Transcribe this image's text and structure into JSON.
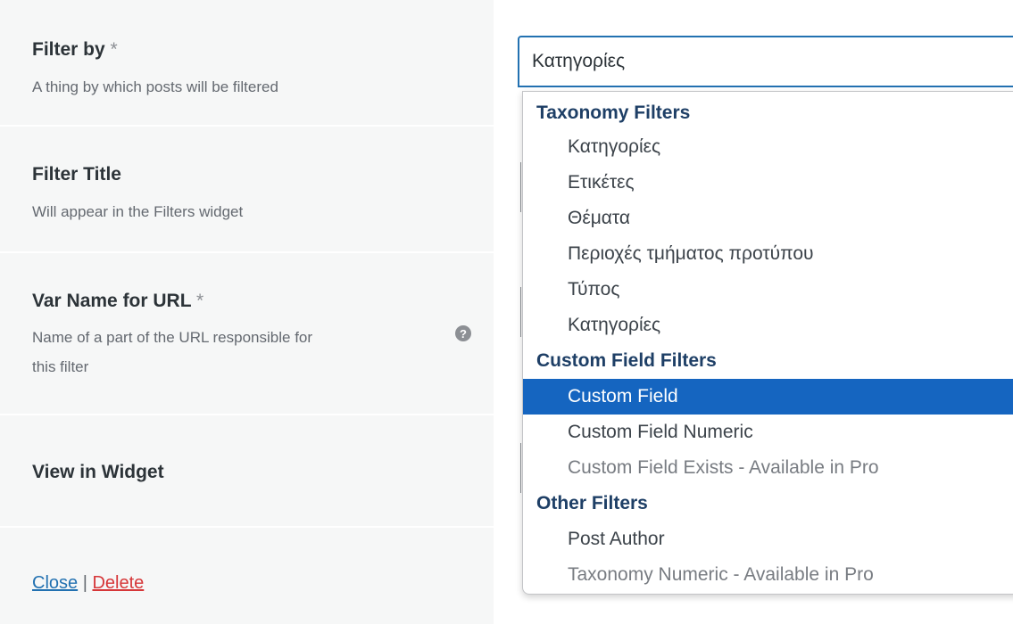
{
  "form": {
    "rows": [
      {
        "title": "Filter by",
        "required": "*",
        "description": "A thing by which posts will be filtered"
      },
      {
        "title": "Filter Title",
        "description": "Will appear in the Filters widget"
      },
      {
        "title": "Var Name for URL",
        "required": "*",
        "description_line1": "Name of a part of the URL responsible for",
        "description_line2": "this filter"
      },
      {
        "title": "View in Widget"
      }
    ],
    "help_glyph": "?",
    "links": {
      "close": "Close",
      "separator": "|",
      "delete": "Delete"
    }
  },
  "select": {
    "value": "Κατηγορίες",
    "groups": [
      {
        "label": "Taxonomy Filters",
        "options": [
          {
            "label": "Κατηγορίες",
            "state": "normal"
          },
          {
            "label": "Ετικέτες",
            "state": "normal"
          },
          {
            "label": "Θέματα",
            "state": "normal"
          },
          {
            "label": "Περιοχές τμήματος προτύπου",
            "state": "normal"
          },
          {
            "label": "Τύπος",
            "state": "normal"
          },
          {
            "label": "Κατηγορίες",
            "state": "normal"
          }
        ]
      },
      {
        "label": "Custom Field Filters",
        "options": [
          {
            "label": "Custom Field",
            "state": "selected"
          },
          {
            "label": "Custom Field Numeric",
            "state": "normal"
          },
          {
            "label": "Custom Field Exists - Available in Pro",
            "state": "disabled"
          }
        ]
      },
      {
        "label": "Other Filters",
        "options": [
          {
            "label": "Post Author",
            "state": "normal"
          },
          {
            "label": "Taxonomy Numeric - Available in Pro",
            "state": "disabled"
          }
        ]
      }
    ]
  },
  "colors": {
    "accent": "#2271b1",
    "selected_bg": "#1565c0",
    "delete": "#d63638",
    "group_label": "#1e3f66"
  }
}
